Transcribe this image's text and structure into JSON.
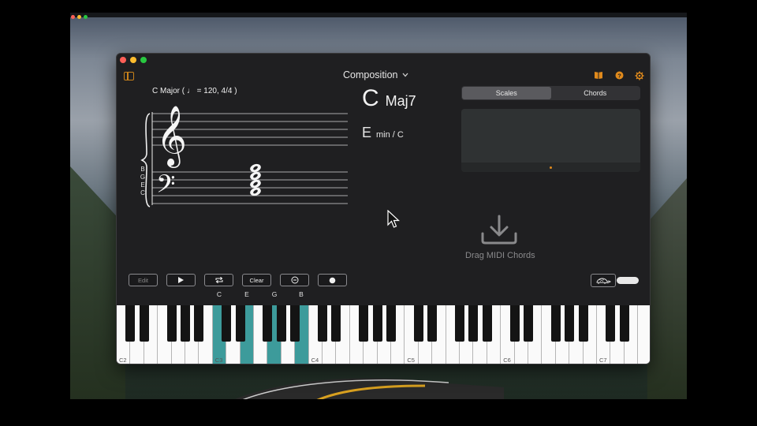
{
  "desktop": {
    "ghost_text": ""
  },
  "window": {
    "title": "Composition",
    "icons": [
      "sidebar-icon",
      "book-icon",
      "help-icon",
      "gear-icon"
    ]
  },
  "staff": {
    "header": "C Major ( ♩ = 120, 4/4 )",
    "chord_notes_stacked": [
      "B",
      "G",
      "E",
      "C"
    ]
  },
  "chord": {
    "root": "C",
    "quality": "Maj7",
    "alt_root": "E",
    "alt_quality": "min / C"
  },
  "tabs": [
    {
      "label": "Scales",
      "active": true
    },
    {
      "label": "Chords",
      "active": false
    }
  ],
  "drop": {
    "label": "Drag MIDI Chords"
  },
  "transport": {
    "edit_label": "Edit",
    "clear_label": "Clear",
    "note_labels": [
      "C",
      "E",
      "G",
      "B"
    ]
  },
  "piano": {
    "octave_labels": [
      "C2",
      "C3",
      "C4",
      "C5",
      "C6",
      "C7"
    ],
    "highlight_color": "#3d9b9b",
    "highlighted_notes": [
      "C3",
      "E3",
      "G3",
      "B3"
    ]
  },
  "colors": {
    "accent": "#e08a1c",
    "window_bg": "#1f1f21"
  }
}
